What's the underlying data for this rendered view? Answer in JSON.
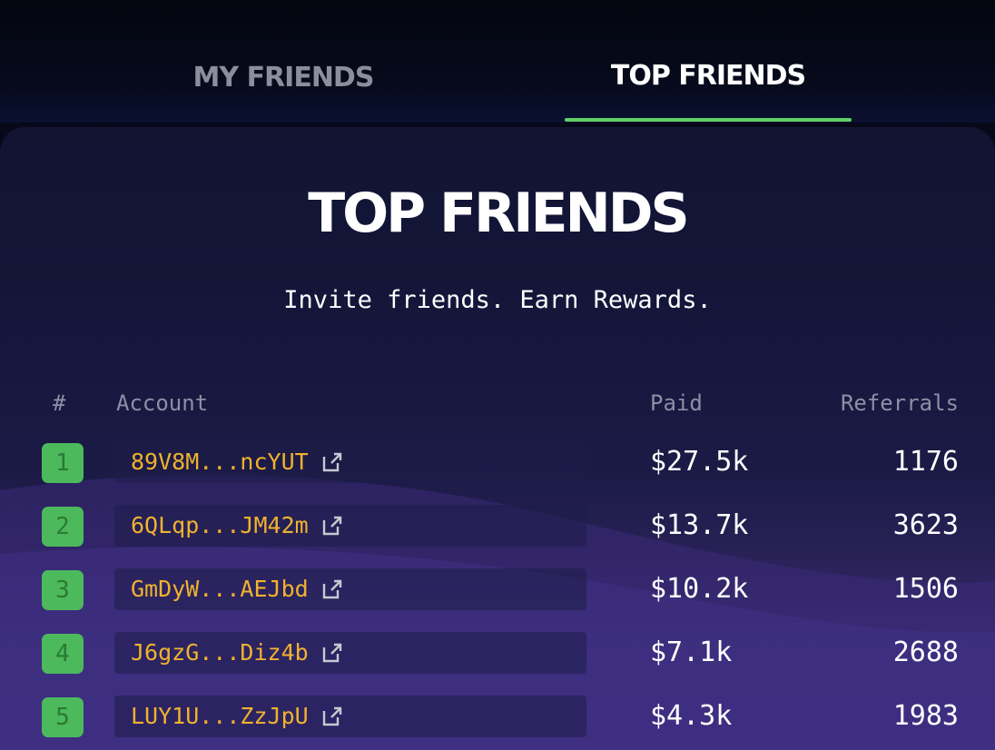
{
  "tabs": [
    {
      "label": "MY FRIENDS",
      "active": false
    },
    {
      "label": "TOP FRIENDS",
      "active": true
    }
  ],
  "heading": "TOP FRIENDS",
  "subtitle": "Invite friends. Earn Rewards.",
  "table": {
    "headers": {
      "rank": "#",
      "account": "Account",
      "paid": "Paid",
      "referrals": "Referrals"
    },
    "rows": [
      {
        "rank": "1",
        "account": "89V8M...ncYUT",
        "paid": "$27.5k",
        "referrals": "1176"
      },
      {
        "rank": "2",
        "account": "6QLqp...JM42m",
        "paid": "$13.7k",
        "referrals": "3623"
      },
      {
        "rank": "3",
        "account": "GmDyW...AEJbd",
        "paid": "$10.2k",
        "referrals": "1506"
      },
      {
        "rank": "4",
        "account": "J6gzG...Diz4b",
        "paid": "$7.1k",
        "referrals": "2688"
      },
      {
        "rank": "5",
        "account": "LUY1U...ZzJpU",
        "paid": "$4.3k",
        "referrals": "1983"
      }
    ]
  },
  "colors": {
    "accent_green": "#5fd068",
    "account_gold": "#f0b22e",
    "rank_badge": "#4cb95c"
  },
  "icons": {
    "row_action": "external-link-icon"
  }
}
